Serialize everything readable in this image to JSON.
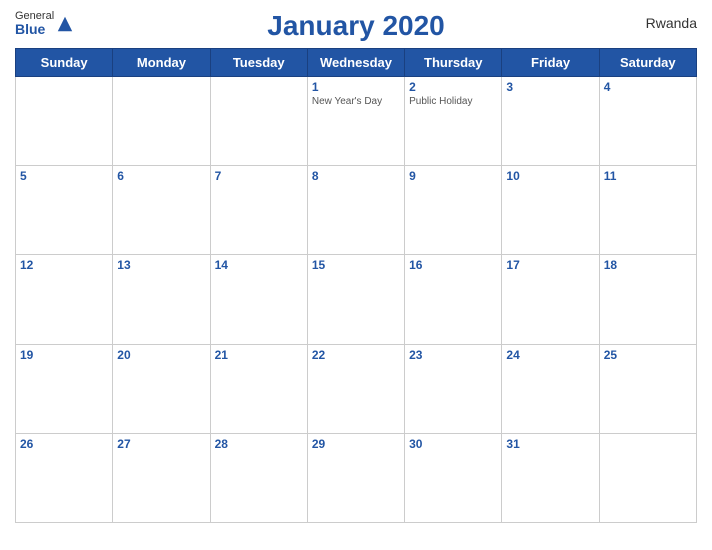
{
  "header": {
    "title": "January 2020",
    "country": "Rwanda",
    "logo_general": "General",
    "logo_blue": "Blue"
  },
  "weekdays": [
    "Sunday",
    "Monday",
    "Tuesday",
    "Wednesday",
    "Thursday",
    "Friday",
    "Saturday"
  ],
  "weeks": [
    [
      {
        "day": "",
        "event": ""
      },
      {
        "day": "",
        "event": ""
      },
      {
        "day": "",
        "event": ""
      },
      {
        "day": "1",
        "event": "New Year's Day"
      },
      {
        "day": "2",
        "event": "Public Holiday"
      },
      {
        "day": "3",
        "event": ""
      },
      {
        "day": "4",
        "event": ""
      }
    ],
    [
      {
        "day": "5",
        "event": ""
      },
      {
        "day": "6",
        "event": ""
      },
      {
        "day": "7",
        "event": ""
      },
      {
        "day": "8",
        "event": ""
      },
      {
        "day": "9",
        "event": ""
      },
      {
        "day": "10",
        "event": ""
      },
      {
        "day": "11",
        "event": ""
      }
    ],
    [
      {
        "day": "12",
        "event": ""
      },
      {
        "day": "13",
        "event": ""
      },
      {
        "day": "14",
        "event": ""
      },
      {
        "day": "15",
        "event": ""
      },
      {
        "day": "16",
        "event": ""
      },
      {
        "day": "17",
        "event": ""
      },
      {
        "day": "18",
        "event": ""
      }
    ],
    [
      {
        "day": "19",
        "event": ""
      },
      {
        "day": "20",
        "event": ""
      },
      {
        "day": "21",
        "event": ""
      },
      {
        "day": "22",
        "event": ""
      },
      {
        "day": "23",
        "event": ""
      },
      {
        "day": "24",
        "event": ""
      },
      {
        "day": "25",
        "event": ""
      }
    ],
    [
      {
        "day": "26",
        "event": ""
      },
      {
        "day": "27",
        "event": ""
      },
      {
        "day": "28",
        "event": ""
      },
      {
        "day": "29",
        "event": ""
      },
      {
        "day": "30",
        "event": ""
      },
      {
        "day": "31",
        "event": ""
      },
      {
        "day": "",
        "event": ""
      }
    ]
  ]
}
